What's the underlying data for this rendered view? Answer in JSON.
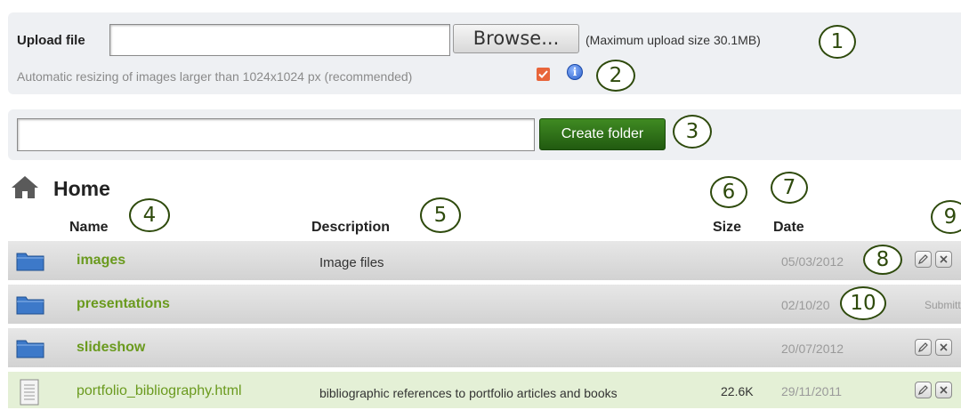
{
  "upload": {
    "label": "Upload file",
    "browse_label": "Browse...",
    "max_size": "(Maximum upload size 30.1MB)",
    "resize_text": "Automatic resizing of images larger than 1024x1024 px (recommended)",
    "resize_checked": true
  },
  "folder": {
    "create_label": "Create folder"
  },
  "home": {
    "title": "Home"
  },
  "columns": {
    "name": "Name",
    "description": "Description",
    "size": "Size",
    "date": "Date"
  },
  "callouts": [
    "1",
    "2",
    "3",
    "4",
    "5",
    "6",
    "7",
    "8",
    "9",
    "10"
  ],
  "rows": [
    {
      "name": "images",
      "description": "Image files",
      "size": "",
      "date": "05/03/2012",
      "type": "folder",
      "status": ""
    },
    {
      "name": "presentations",
      "description": "",
      "size": "",
      "date": "02/10/20",
      "type": "folder",
      "status": "Submitted"
    },
    {
      "name": "slideshow",
      "description": "",
      "size": "",
      "date": "20/07/2012",
      "type": "folder",
      "status": ""
    },
    {
      "name": "portfolio_bibliography.html",
      "description": "bibliographic references to portfolio articles and books",
      "size": "22.6K",
      "date": "29/11/2011",
      "type": "file",
      "status": ""
    }
  ],
  "colors": {
    "accent_green": "#2e6b14",
    "link_green": "#6a9a1e",
    "panel": "#eef0f3",
    "checkbox": "#e8653a"
  },
  "icons": {
    "home": "home-icon",
    "folder": "folder-icon",
    "file": "file-icon",
    "info": "info-icon",
    "edit": "edit-icon",
    "delete": "delete-icon"
  }
}
